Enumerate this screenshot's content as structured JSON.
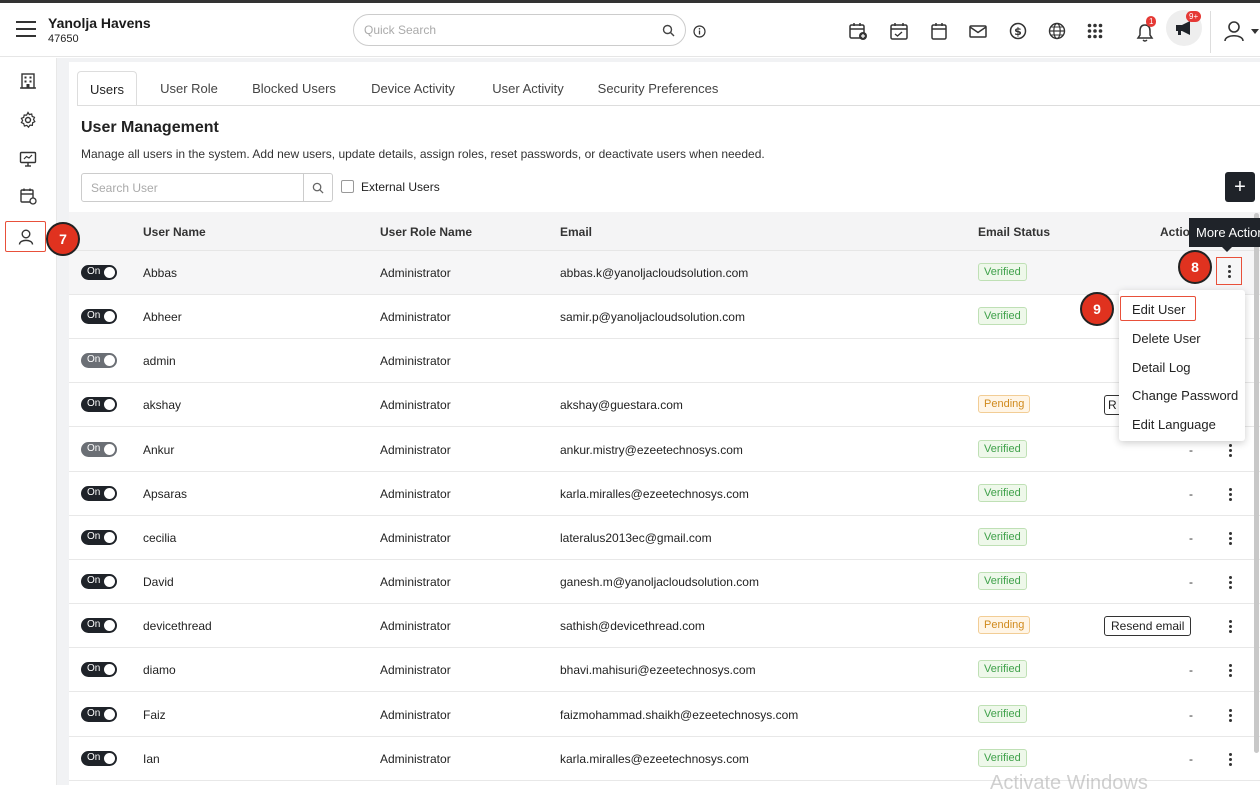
{
  "header": {
    "property_name": "Yanolja Havens",
    "property_id": "47650",
    "search_placeholder": "Quick Search",
    "notifications_badge": "1",
    "announcements_badge": "9+"
  },
  "tabs": [
    {
      "label": "Users",
      "active": true
    },
    {
      "label": "User Role"
    },
    {
      "label": "Blocked Users"
    },
    {
      "label": "Device Activity"
    },
    {
      "label": "User Activity"
    },
    {
      "label": "Security Preferences"
    }
  ],
  "page": {
    "title": "User Management",
    "description": "Manage all users in the system. Add new users, update details, assign roles, reset passwords, or deactivate users when needed.",
    "search_placeholder": "Search User",
    "external_users_label": "External Users",
    "add_label": "+"
  },
  "table": {
    "columns": [
      "User Name",
      "User Role Name",
      "Email",
      "Email Status",
      "Action"
    ],
    "rows": [
      {
        "toggle": "On",
        "name": "Abbas",
        "role": "Administrator",
        "email": "abbas.k@yanoljacloudsolution.com",
        "status": "Verified"
      },
      {
        "toggle": "On",
        "name": "Abheer",
        "role": "Administrator",
        "email": "samir.p@yanoljacloudsolution.com",
        "status": "Verified"
      },
      {
        "toggle": "On",
        "name": "admin",
        "role": "Administrator",
        "email": "",
        "status": ""
      },
      {
        "toggle": "On",
        "name": "akshay",
        "role": "Administrator",
        "email": "akshay@guestara.com",
        "status": "Pending"
      },
      {
        "toggle": "On",
        "name": "Ankur",
        "role": "Administrator",
        "email": "ankur.mistry@ezeetechnosys.com",
        "status": "Verified",
        "action": "-"
      },
      {
        "toggle": "On",
        "name": "Apsaras",
        "role": "Administrator",
        "email": "karla.miralles@ezeetechnosys.com",
        "status": "Verified",
        "action": "-"
      },
      {
        "toggle": "On",
        "name": "cecilia",
        "role": "Administrator",
        "email": "lateralus2013ec@gmail.com",
        "status": "Verified",
        "action": "-"
      },
      {
        "toggle": "On",
        "name": "David",
        "role": "Administrator",
        "email": "ganesh.m@yanoljacloudsolution.com",
        "status": "Verified",
        "action": "-"
      },
      {
        "toggle": "On",
        "name": "devicethread",
        "role": "Administrator",
        "email": "sathish@devicethread.com",
        "status": "Pending",
        "action": "Resend email"
      },
      {
        "toggle": "On",
        "name": "diamo",
        "role": "Administrator",
        "email": "bhavi.mahisuri@ezeetechnosys.com",
        "status": "Verified",
        "action": "-"
      },
      {
        "toggle": "On",
        "name": "Faiz",
        "role": "Administrator",
        "email": "faizmohammad.shaikh@ezeetechnosys.com",
        "status": "Verified",
        "action": "-"
      },
      {
        "toggle": "On",
        "name": "Ian",
        "role": "Administrator",
        "email": "karla.miralles@ezeetechnosys.com",
        "status": "Verified",
        "action": "-"
      }
    ]
  },
  "tooltip": "More Actions",
  "menu": [
    "Edit User",
    "Delete User",
    "Detail Log",
    "Change Password",
    "Edit Language"
  ],
  "partial_button_text": "R",
  "steps": [
    "7",
    "8",
    "9"
  ],
  "watermark": "Activate Windows",
  "colors": {
    "accent": "#e8503a",
    "step": "#e0321f",
    "verified": "#3fa14a",
    "pending": "#d08a1d",
    "dark": "#1f2329"
  }
}
